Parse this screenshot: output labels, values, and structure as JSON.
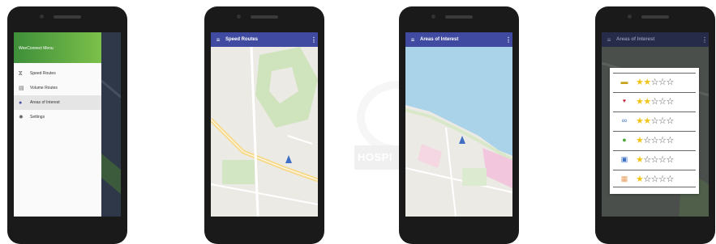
{
  "colors": {
    "appbar": "#3f4aa0",
    "drawer_header": "#5aa843",
    "star": "#f0c419"
  },
  "background": {
    "watermark": "HOSPI"
  },
  "phone1": {
    "drawer_title": "WeeConnect Menu",
    "items": [
      {
        "icon": "bike-icon",
        "label": "Speed Routes"
      },
      {
        "icon": "volume-icon",
        "label": "Volume Routes"
      },
      {
        "icon": "location-pin-icon",
        "label": "Areas of Interest",
        "active": true
      },
      {
        "icon": "gear-icon",
        "label": "Settings"
      }
    ]
  },
  "phone2": {
    "title": "Speed Routes"
  },
  "phone3": {
    "title": "Areas of Interest"
  },
  "phone4": {
    "title": "Areas of Interest",
    "ratings": [
      {
        "icon": "car-icon",
        "stars": 2,
        "max": 5
      },
      {
        "icon": "heart-icon",
        "stars": 2,
        "max": 5
      },
      {
        "icon": "bicycle-icon",
        "stars": 2,
        "max": 5
      },
      {
        "icon": "tree-icon",
        "stars": 1,
        "max": 5
      },
      {
        "icon": "bus-icon",
        "stars": 1,
        "max": 5
      },
      {
        "icon": "building-icon",
        "stars": 1,
        "max": 5
      }
    ]
  }
}
